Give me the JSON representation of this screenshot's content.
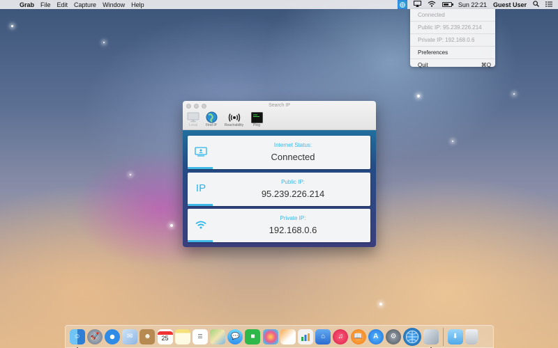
{
  "menubar": {
    "app_name": "Grab",
    "menus": [
      "File",
      "Edit",
      "Capture",
      "Window",
      "Help"
    ],
    "clock": "Sun 22:21",
    "user": "Guest User",
    "battery_level": 0.75
  },
  "dropdown": {
    "status": "Connected",
    "public_ip": "Public IP: 95.239.226.214",
    "private_ip": "Private IP: 192.168.0.6",
    "preferences": "Preferences",
    "quit": "Quit",
    "quit_shortcut": "⌘Q"
  },
  "window": {
    "title": "Search IP",
    "tabs": [
      {
        "label": "Local",
        "icon": "monitor-icon"
      },
      {
        "label": "Find IP",
        "icon": "globe-icon"
      },
      {
        "label": "Reachability",
        "icon": "broadcast-icon"
      },
      {
        "label": "Ping",
        "icon": "terminal-icon"
      }
    ],
    "cards": [
      {
        "label": "Internet Status:",
        "value": "Connected",
        "icon": "computer-icon"
      },
      {
        "label": "Public IP:",
        "value": "95.239.226.214",
        "icon_text": "IP"
      },
      {
        "label": "Private IP:",
        "value": "192.168.0.6",
        "icon": "wifi-icon"
      }
    ]
  },
  "dock": {
    "calendar_day": "25",
    "apps": [
      "finder-icon",
      "launchpad-icon",
      "safari-icon",
      "mail-icon",
      "contacts-icon",
      "calendar-icon",
      "notes-icon",
      "reminders-icon",
      "maps-icon",
      "messages-icon",
      "facetime-icon",
      "photos-icon",
      "pages-icon",
      "numbers-icon",
      "keynote-icon",
      "itunes-icon",
      "ibooks-icon",
      "app-store-icon",
      "system-preferences-icon",
      "search-ip-icon",
      "preview-icon",
      "downloads-icon",
      "trash-icon"
    ]
  }
}
